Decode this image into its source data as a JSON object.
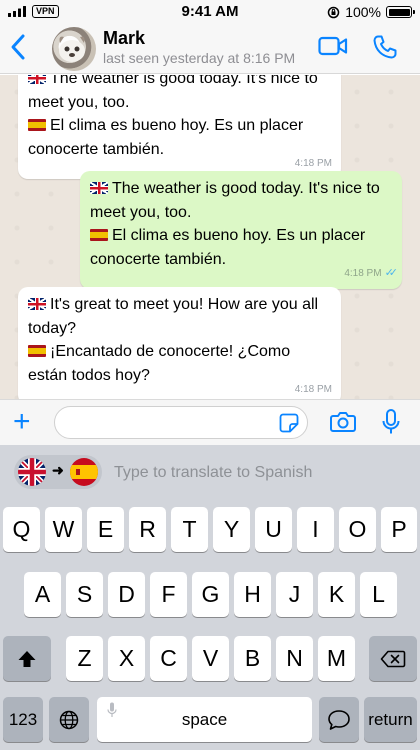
{
  "status_bar": {
    "vpn": "VPN",
    "time": "9:41 AM",
    "battery": "100%"
  },
  "header": {
    "contact_name": "Mark",
    "last_seen": "last seen yesterday at 8:16 PM",
    "back_icon": "chevron-left-icon",
    "video_icon": "video-camera-icon",
    "call_icon": "phone-icon",
    "accent_color": "#0a84ff"
  },
  "messages": [
    {
      "direction": "in",
      "lines": [
        {
          "flag": "uk",
          "text": "The weather is good today. It's nice to"
        },
        {
          "flag": "",
          "text": "meet you, too."
        },
        {
          "flag": "es",
          "text": "El clima es bueno hoy. Es un placer"
        },
        {
          "flag": "",
          "text": "conocerte también."
        }
      ],
      "time": "4:18 PM"
    },
    {
      "direction": "out",
      "lines": [
        {
          "flag": "uk",
          "text": "The weather is good today. It's nice to"
        },
        {
          "flag": "",
          "text": "meet you, too."
        },
        {
          "flag": "es",
          "text": "El clima es bueno hoy. Es un placer"
        },
        {
          "flag": "",
          "text": "conocerte también."
        }
      ],
      "time": "4:18 PM",
      "status": "read"
    },
    {
      "direction": "in",
      "lines": [
        {
          "flag": "uk",
          "text": "It's great to meet you! How are you all"
        },
        {
          "flag": "",
          "text": "today?"
        },
        {
          "flag": "es",
          "text": "¡Encantado de conocerte! ¿Como"
        },
        {
          "flag": "",
          "text": "están todos hoy?"
        }
      ],
      "time": "4:18 PM"
    }
  ],
  "colors": {
    "incoming_bubble": "#ffffff",
    "outgoing_bubble": "#dcf8c6",
    "chat_background": "#ece5dd",
    "read_ticks": "#4fb6ec"
  },
  "input_bar": {
    "plus_label": "+",
    "message_value": "",
    "icons": [
      "plus-icon",
      "sticker-icon",
      "camera-icon",
      "microphone-icon"
    ]
  },
  "translator": {
    "from_flag": "uk",
    "to_flag": "es",
    "arrow": "➜",
    "placeholder": "Type to translate to Spanish"
  },
  "keyboard": {
    "row1": [
      "Q",
      "W",
      "E",
      "R",
      "T",
      "Y",
      "U",
      "I",
      "O",
      "P"
    ],
    "row2": [
      "A",
      "S",
      "D",
      "F",
      "G",
      "H",
      "J",
      "K",
      "L"
    ],
    "row3": [
      "Z",
      "X",
      "C",
      "V",
      "B",
      "N",
      "M"
    ],
    "numbers_key": "123",
    "space_key": "space",
    "return_key": "return"
  }
}
